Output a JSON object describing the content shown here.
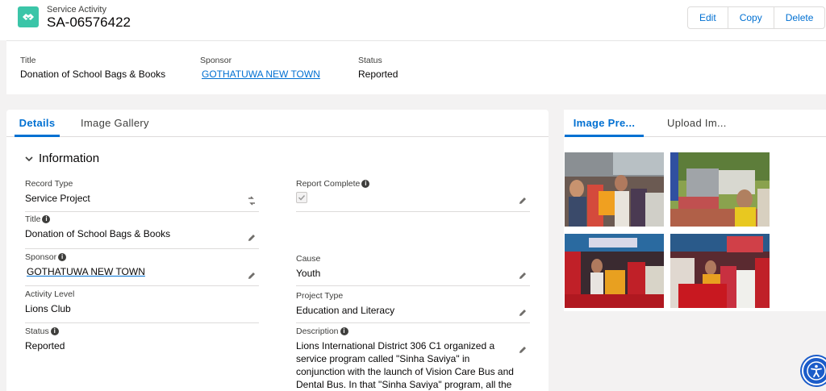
{
  "header": {
    "object_type": "Service Activity",
    "record_name": "SA-06576422",
    "icon": "handshake-icon",
    "buttons": {
      "edit": "Edit",
      "copy": "Copy",
      "delete": "Delete"
    }
  },
  "highlights": {
    "title_label": "Title",
    "title_value": "Donation of School Bags & Books",
    "sponsor_label": "Sponsor",
    "sponsor_value": "GOTHATUWA NEW TOWN",
    "status_label": "Status",
    "status_value": "Reported"
  },
  "tabs": {
    "details": "Details",
    "image_gallery": "Image Gallery"
  },
  "section": {
    "title": "Information"
  },
  "fields": {
    "record_type_label": "Record Type",
    "record_type_value": "Service Project",
    "report_complete_label": "Report Complete",
    "title_label": "Title",
    "title_value": "Donation of School Bags & Books",
    "sponsor_label": "Sponsor",
    "sponsor_value": "GOTHATUWA NEW TOWN",
    "cause_label": "Cause",
    "cause_value": "Youth",
    "activity_level_label": "Activity Level",
    "activity_level_value": "Lions Club",
    "project_type_label": "Project Type",
    "project_type_value": "Education and Literacy",
    "status_label": "Status",
    "status_value": "Reported",
    "description_label": "Description",
    "description_value": "Lions International District 306 C1 organized a service program called \"Sinha Saviya\" in conjunction with the launch of Vision Care Bus and Dental Bus. In that \"Sinha Saviya\" program, all the Lions Clubs of Region"
  },
  "side_tabs": {
    "image_preview": "Image Pre...",
    "upload_image": "Upload Im..."
  },
  "colors": {
    "brand": "#0070d2",
    "icon_teal": "#3bc5a8",
    "accessibility": "#1b5cc9"
  }
}
